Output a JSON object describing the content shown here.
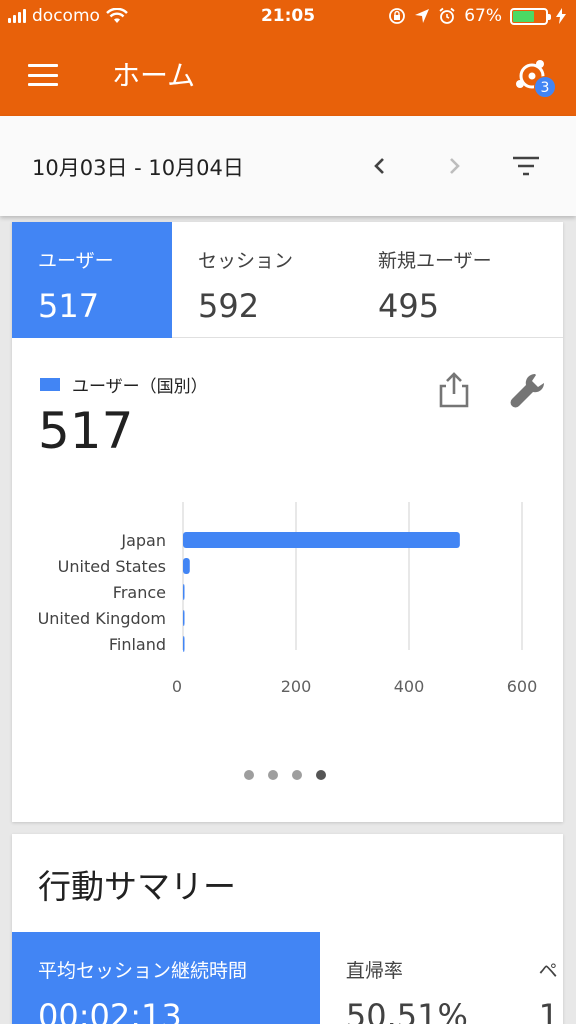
{
  "status": {
    "carrier": "docomo",
    "time": "21:05",
    "battery": "67%",
    "battery_level": 0.67
  },
  "appbar": {
    "title": "ホーム",
    "notification_count": "3"
  },
  "datebar": {
    "range": "10月03日 - 10月04日"
  },
  "metrics": [
    {
      "label": "ユーザー",
      "value": "517"
    },
    {
      "label": "セッション",
      "value": "592"
    },
    {
      "label": "新規ユーザー",
      "value": "495"
    }
  ],
  "chart_card": {
    "legend": "ユーザー（国別）",
    "total": "517"
  },
  "chart_data": {
    "type": "bar",
    "orientation": "horizontal",
    "categories": [
      "Japan",
      "United States",
      "France",
      "United Kingdom",
      "Finland"
    ],
    "values": [
      490,
      12,
      2,
      2,
      1
    ],
    "xlim": [
      0,
      600
    ],
    "xticks": [
      0,
      200,
      400,
      600
    ],
    "grid": true,
    "color": "#4285f4"
  },
  "pagination": {
    "count": 4,
    "active": 3
  },
  "summary": {
    "title": "行動サマリー",
    "metrics": [
      {
        "label": "平均セッション継続時間",
        "value": "00:02:13"
      },
      {
        "label": "直帰率",
        "value": "50.51%"
      },
      {
        "label": "ペ",
        "value": "1"
      }
    ]
  },
  "colors": {
    "brand": "#e8610a",
    "accent": "#4285f4"
  }
}
